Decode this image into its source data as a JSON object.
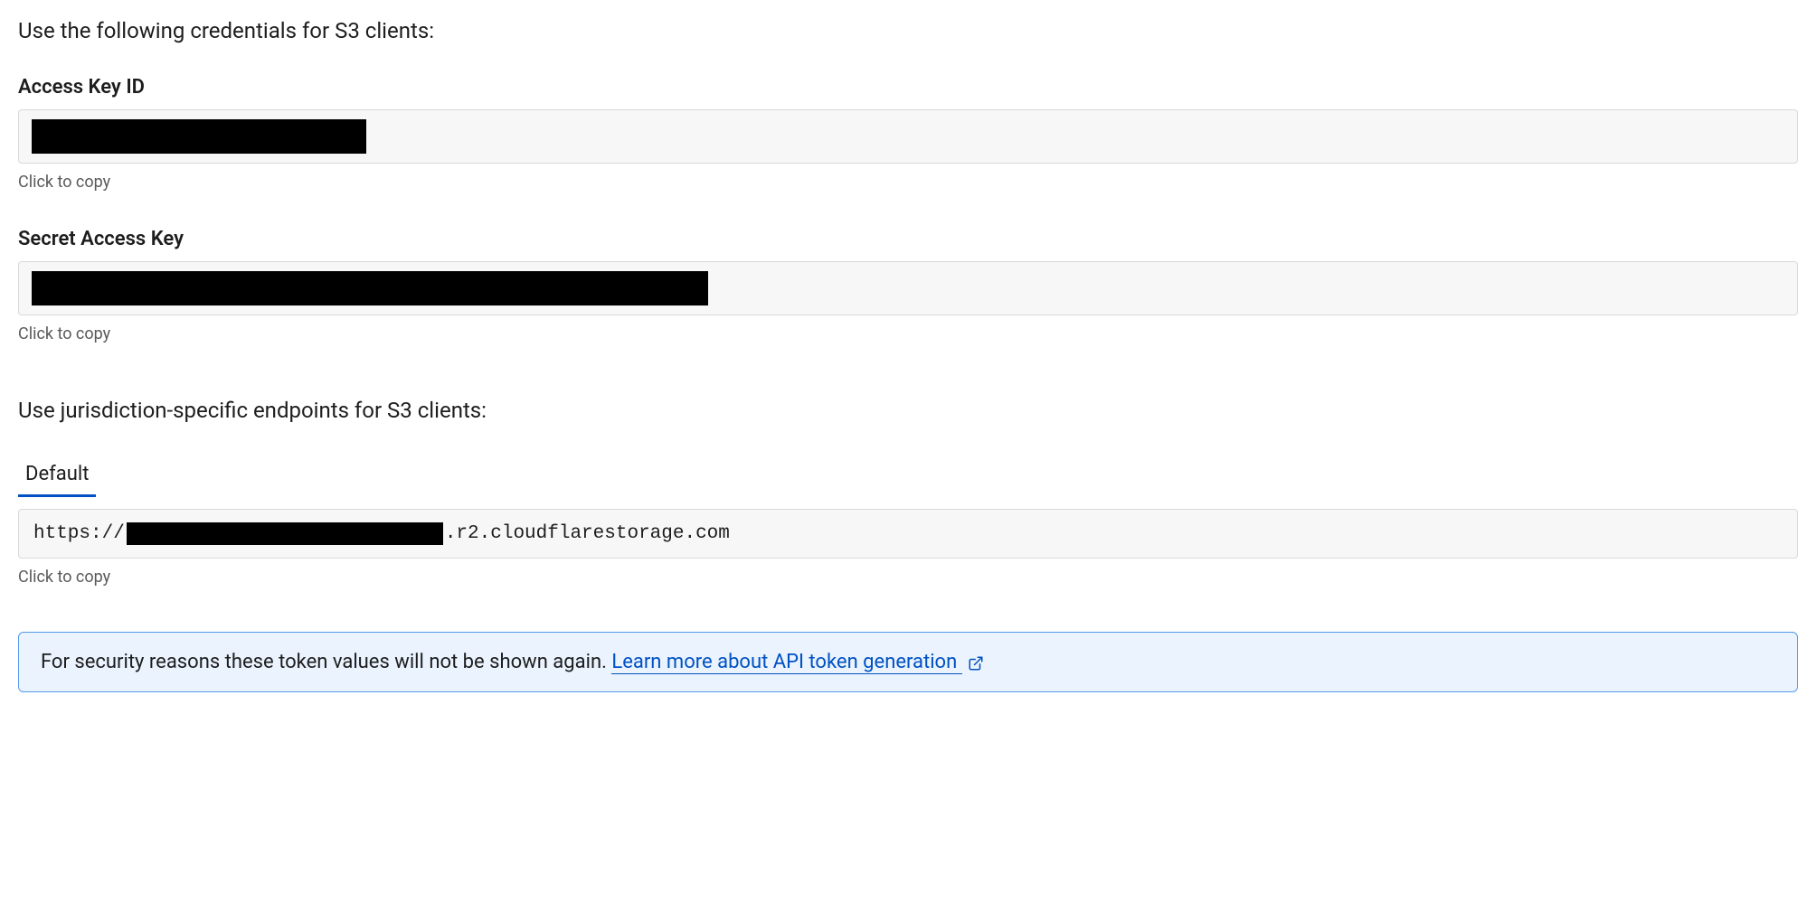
{
  "credentials_intro": "Use the following credentials for S3 clients:",
  "access_key": {
    "label": "Access Key ID",
    "helper": "Click to copy"
  },
  "secret_key": {
    "label": "Secret Access Key",
    "helper": "Click to copy"
  },
  "endpoints_intro": "Use jurisdiction-specific endpoints for S3 clients:",
  "tabs": {
    "default": "Default"
  },
  "endpoint": {
    "prefix": "https://",
    "suffix": ".r2.cloudflarestorage.com",
    "helper": "Click to copy"
  },
  "banner": {
    "text": "For security reasons these token values will not be shown again. ",
    "link_text": "Learn more about API token generation"
  }
}
